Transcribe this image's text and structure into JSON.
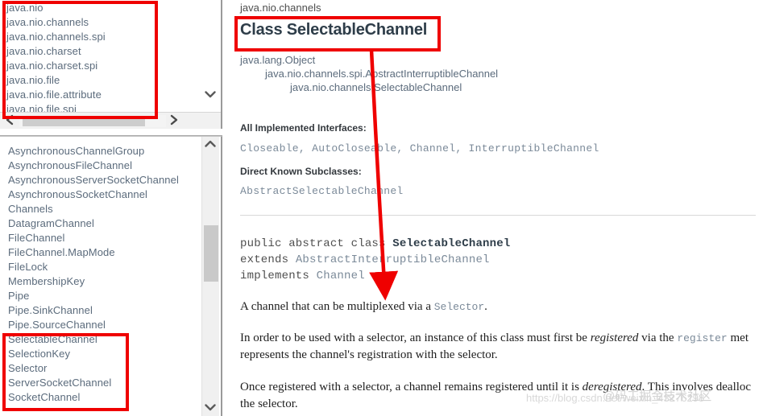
{
  "left_panel": {
    "packages": {
      "items": [
        "java.nio",
        "java.nio.channels",
        "java.nio.channels.spi",
        "java.nio.charset",
        "java.nio.charset.spi",
        "java.nio.file",
        "java.nio.file.attribute",
        "java.nio.file.spi"
      ],
      "scroll_down_icon": "chevron-down-icon",
      "hscroll_left_icon": "chevron-left-icon",
      "hscroll_right_icon": "chevron-right-icon"
    },
    "classes": {
      "items": [
        "AsynchronousChannelGroup",
        "AsynchronousFileChannel",
        "AsynchronousServerSocketChannel",
        "AsynchronousSocketChannel",
        "Channels",
        "DatagramChannel",
        "FileChannel",
        "FileChannel.MapMode",
        "FileLock",
        "MembershipKey",
        "Pipe",
        "Pipe.SinkChannel",
        "Pipe.SourceChannel",
        "SelectableChannel",
        "SelectionKey",
        "Selector",
        "ServerSocketChannel",
        "SocketChannel"
      ],
      "scroll_up_icon": "chevron-up-icon",
      "scroll_down_icon": "chevron-down-icon"
    }
  },
  "main": {
    "package_breadcrumb": "java.nio.channels",
    "title": "Class SelectableChannel",
    "inheritance": [
      "java.lang.Object",
      "java.nio.channels.spi.AbstractInterruptibleChannel",
      "java.nio.channels.SelectableChannel"
    ],
    "implemented_interfaces_label": "All Implemented Interfaces:",
    "implemented_interfaces_value": "Closeable, AutoCloseable, Channel, InterruptibleChannel",
    "subclasses_label": "Direct Known Subclasses:",
    "subclasses_value": "AbstractSelectableChannel",
    "declaration": {
      "line1_modifiers": "public abstract class ",
      "line1_name": "SelectableChannel",
      "line2_keyword": "extends ",
      "line2_type": "AbstractInterruptibleChannel",
      "line3_keyword": "implements ",
      "line3_type": "Channel"
    },
    "paragraphs": {
      "p1_before": "A channel that can be multiplexed via a ",
      "p1_code": "Selector",
      "p1_after": ".",
      "p2_a": "In order to be used with a selector, an instance of this class must first be ",
      "p2_em": "registered",
      "p2_b": " via the ",
      "p2_code": "register",
      "p2_c": " met",
      "p2_line2": "represents the channel's registration with the selector.",
      "p3_a": "Once registered with a selector, a channel remains registered until it is ",
      "p3_em": "deregistered",
      "p3_b": ". This involves dealloc",
      "p3_line2": "the selector."
    },
    "watermark": {
      "url": "https://blog.csdn.net/weixin_43276298",
      "handle": "@码工掘金技术社区"
    }
  },
  "annotations": {
    "color": "#ef0000",
    "boxes": [
      "packages-highlight",
      "classes-highlight",
      "title-highlight"
    ],
    "arrow": "red-arrow-title-to-description"
  }
}
